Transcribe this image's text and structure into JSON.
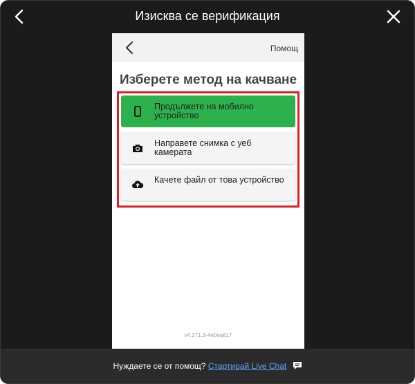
{
  "window": {
    "title": "Изисква се верификация"
  },
  "frame": {
    "help_label": "Помощ",
    "heading": "Изберете метод на качване",
    "options": [
      {
        "icon": "phone-icon",
        "label": "Продължете на мобилно устройство",
        "style": "primary"
      },
      {
        "icon": "camera-icon",
        "label": "Направете снимка с уеб камерата",
        "style": "secondary"
      },
      {
        "icon": "upload-cloud-icon",
        "label": "Качете файл от това устройство",
        "style": "secondary"
      }
    ],
    "version": "v4.271.3-4e0ea617"
  },
  "footer": {
    "question": "Нуждаете се от помощ?",
    "link_label": "Стартирай Live Chat"
  },
  "colors": {
    "modal_background": "#1b1b1b",
    "footer_background": "#2b2b2b",
    "primary_option": "#2db14d",
    "highlight_border": "#e41b24",
    "link": "#5aa7ff"
  }
}
